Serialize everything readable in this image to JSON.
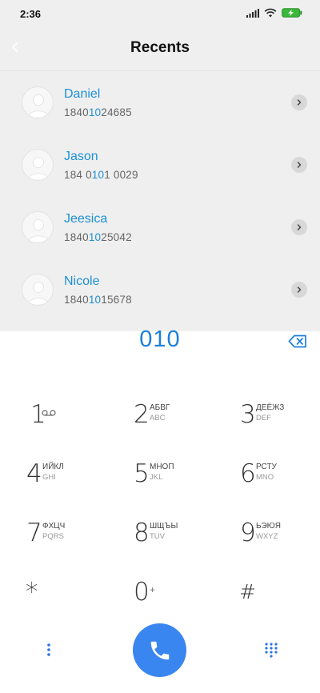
{
  "status": {
    "time": "2:36"
  },
  "header": {
    "title": "Recents"
  },
  "contacts": [
    {
      "name": "Daniel",
      "number_pre": "1840",
      "number_match": "10",
      "number_post": "24685"
    },
    {
      "name": "Jason",
      "number_pre": "184 0",
      "number_match": "10",
      "number_post": "1 0029"
    },
    {
      "name": "Jeesica",
      "number_pre": "1840",
      "number_match": "10",
      "number_post": "25042"
    },
    {
      "name": "Nicole",
      "number_pre": "1840",
      "number_match": "10",
      "number_post": "15678"
    }
  ],
  "dialer": {
    "input": "010",
    "keys": [
      {
        "digit": "1",
        "letters": "",
        "latin": ""
      },
      {
        "digit": "2",
        "letters": "АБВГ",
        "latin": "ABC"
      },
      {
        "digit": "3",
        "letters": "ДЕЁЖЗ",
        "latin": "DEF"
      },
      {
        "digit": "4",
        "letters": "ИЙКЛ",
        "latin": "GHI"
      },
      {
        "digit": "5",
        "letters": "МНОП",
        "latin": "JKL"
      },
      {
        "digit": "6",
        "letters": "РСТУ",
        "latin": "MNO"
      },
      {
        "digit": "7",
        "letters": "ФХЦЧ",
        "latin": "PQRS"
      },
      {
        "digit": "8",
        "letters": "ШЩЪЫ",
        "latin": "TUV"
      },
      {
        "digit": "9",
        "letters": "ЬЭЮЯ",
        "latin": "WXYZ"
      },
      {
        "digit": "*",
        "letters": "",
        "latin": ""
      },
      {
        "digit": "0",
        "letters": "+",
        "latin": ""
      },
      {
        "digit": "#",
        "letters": "",
        "latin": ""
      }
    ]
  },
  "icons": {
    "back": "chevron-left-icon",
    "signal": "signal-icon",
    "wifi": "wifi-icon",
    "battery": "battery-charging-icon",
    "backspace": "backspace-icon",
    "voicemail": "voicemail-icon",
    "more": "more-vertical-icon",
    "call": "phone-icon",
    "keypad": "keypad-icon"
  },
  "colors": {
    "accent": "#1d90d6",
    "call_button": "#3a86f0",
    "battery": "#3bb83b"
  }
}
